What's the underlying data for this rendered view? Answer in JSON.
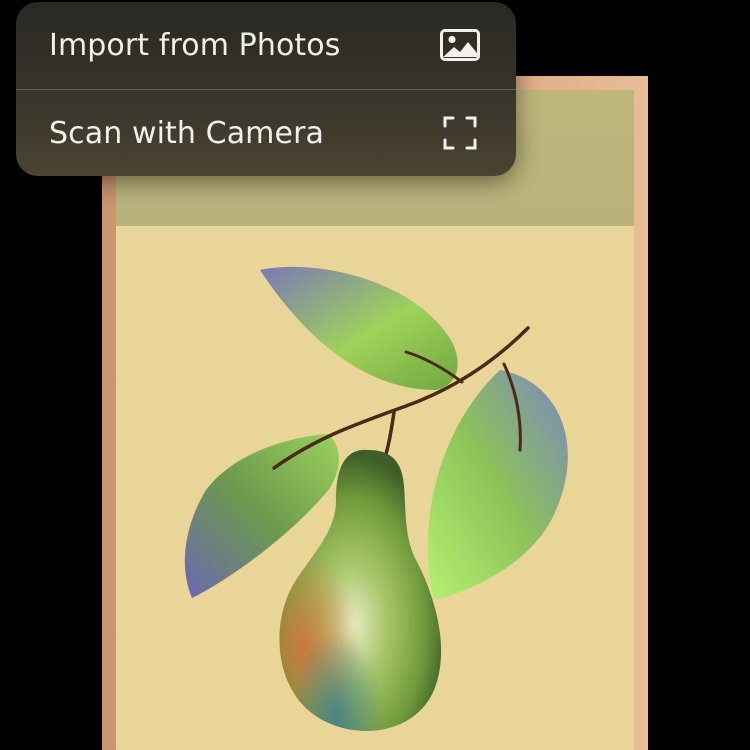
{
  "menu": {
    "items": [
      {
        "label": "Import from Photos",
        "icon": "photo-icon"
      },
      {
        "label": "Scan with Camera",
        "icon": "scan-viewfinder-icon"
      }
    ]
  },
  "artwork": {
    "subject": "pear with leaves illustration",
    "colors": {
      "background": "#000000",
      "frame": "#d9a47c",
      "mat": "#e9d598",
      "mat_top": "#bdb57b",
      "menu": "#35322a",
      "menu_text": "#f2f0ea"
    }
  }
}
